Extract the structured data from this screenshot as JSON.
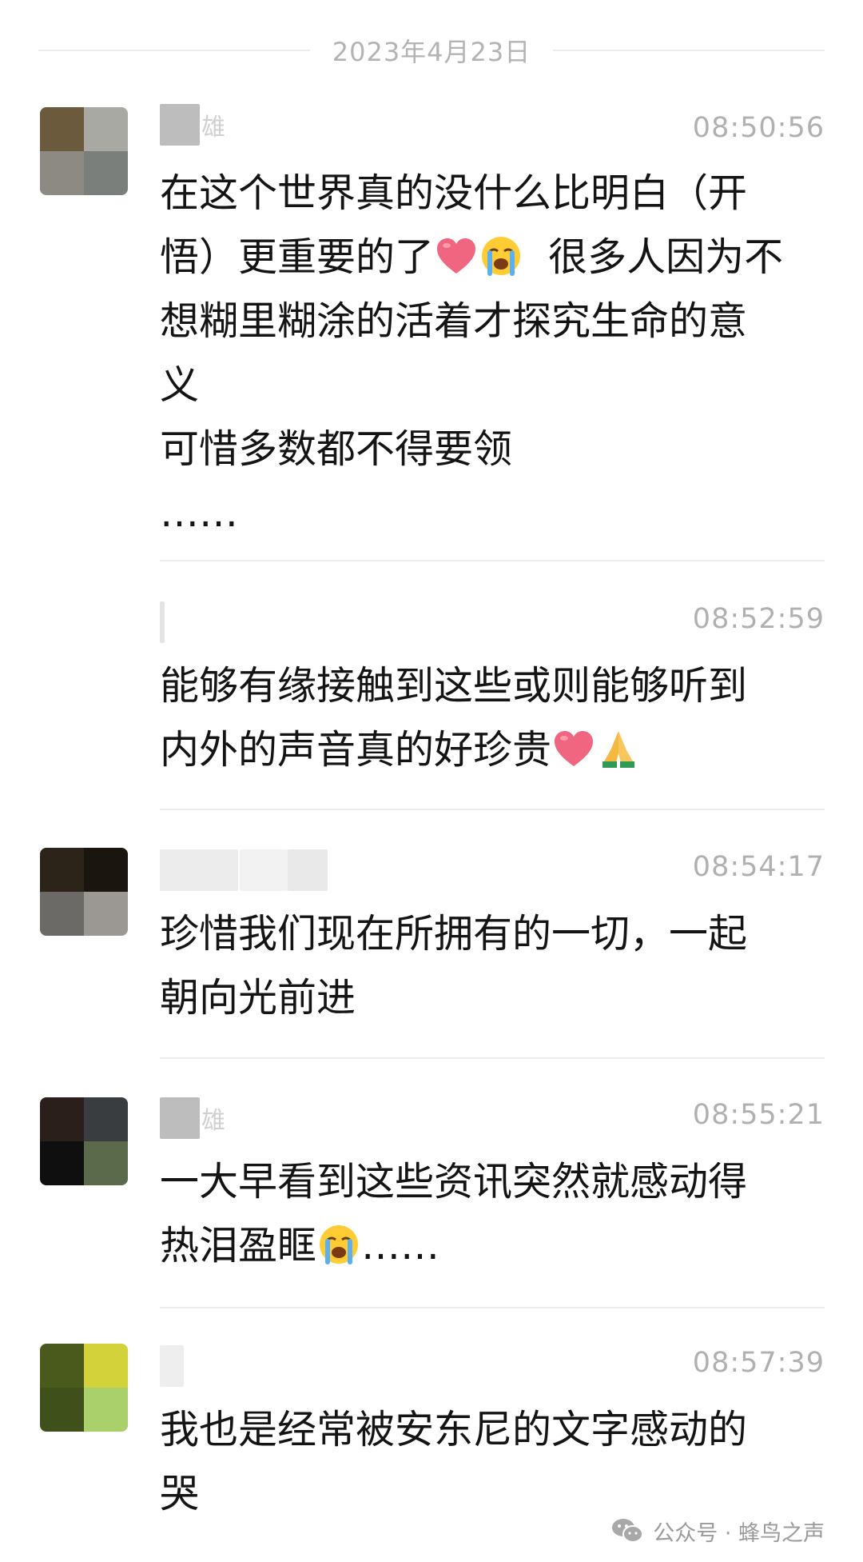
{
  "date": "2023年4月23日",
  "comments": [
    {
      "avatar_colors": [
        "#6b5a3c",
        "#a9a9a4",
        "#8c8a82",
        "#7a7f7c"
      ],
      "name_tail": "雄",
      "time": "08:50:56",
      "lines": [
        [
          "在这个世界真的没什么比明白（开"
        ],
        [
          "悟）更重要的了",
          "heart-emoji",
          "crying-emoji",
          "  很多人因为不"
        ],
        [
          "想糊里糊涂的活着才探究生命的意"
        ],
        [
          "义"
        ],
        [
          "可惜多数都不得要领"
        ],
        [
          "……"
        ]
      ]
    },
    {
      "avatar_colors": [],
      "name_tail": "",
      "time": "08:52:59",
      "lines": [
        [
          "能够有缘接触到这些或则能够听到"
        ],
        [
          "内外的声音真的好珍贵",
          "heart-emoji",
          "pray-emoji"
        ]
      ]
    },
    {
      "avatar_colors": [
        "#2c2418",
        "#1a160f",
        "#6c6a66",
        "#9b9893"
      ],
      "name_tail": "",
      "time": "08:54:17",
      "lines": [
        [
          "珍惜我们现在所拥有的一切，一起"
        ],
        [
          "朝向光前进"
        ]
      ]
    },
    {
      "avatar_colors": [
        "#2a1f1a",
        "#3a3d40",
        "#0f0f10",
        "#5a6a4a"
      ],
      "name_tail": "雄",
      "time": "08:55:21",
      "lines": [
        [
          "一大早看到这些资讯突然就感动得"
        ],
        [
          "热泪盈眶",
          "crying-emoji",
          "……"
        ]
      ]
    },
    {
      "avatar_colors": [
        "#4a5a1c",
        "#d4d23a",
        "#40501a",
        "#a9d06a"
      ],
      "name_tail": "",
      "time": "08:57:39",
      "lines": [
        [
          "我也是经常被安东尼的文字感动的"
        ],
        [
          "哭"
        ]
      ]
    }
  ],
  "watermark": {
    "icon": "wechat-icon",
    "text": "公众号 · 蜂鸟之声"
  }
}
